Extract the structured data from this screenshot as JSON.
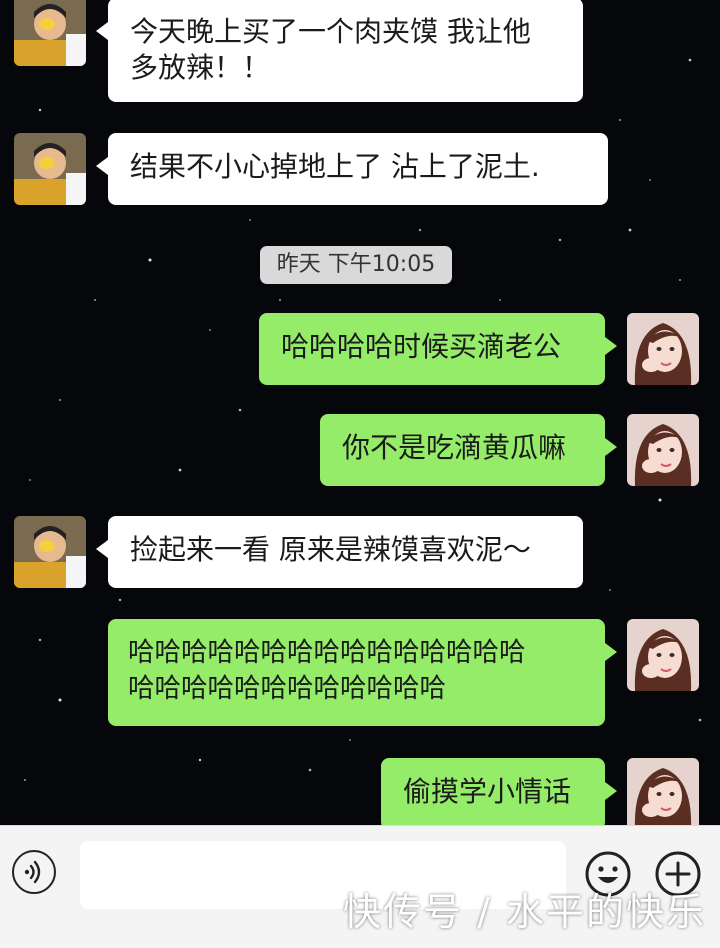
{
  "colors": {
    "background": "#06070b",
    "received_bubble": "#ffffff",
    "sent_bubble": "#95ec69",
    "timestamp_bg": "#d9d9d9"
  },
  "messages": [
    {
      "side": "left",
      "text": "今天晚上买了一个肉夹馍 我让他\n多放辣！！"
    },
    {
      "side": "left",
      "text": "结果不小心掉地上了 沾上了泥土."
    },
    {
      "side": "right",
      "text": "哈哈哈哈时候买滴老公"
    },
    {
      "side": "right",
      "text": "你不是吃滴黄瓜嘛"
    },
    {
      "side": "left",
      "text": "捡起来一看 原来是辣馍喜欢泥～"
    },
    {
      "side": "right",
      "text": "哈哈哈哈哈哈哈哈哈哈哈哈哈哈哈\n哈哈哈哈哈哈哈哈哈哈哈哈"
    },
    {
      "side": "right",
      "text": "偷摸学小情话"
    }
  ],
  "timestamp": "昨天 下午10:05",
  "input_bar": {
    "voice_icon": "voice-icon",
    "emoji_icon": "emoji-icon",
    "plus_icon": "plus-icon",
    "input_value": ""
  },
  "watermark": "快传号 / 水平的快乐"
}
